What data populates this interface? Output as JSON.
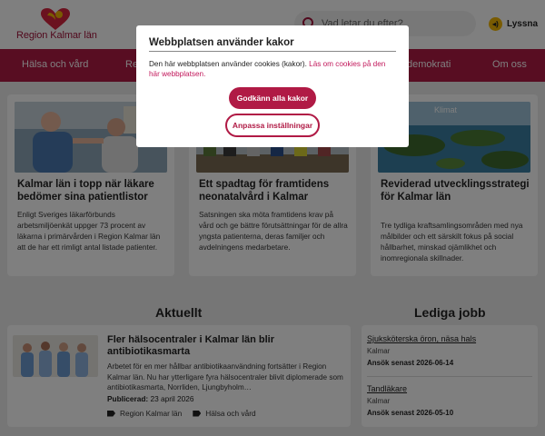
{
  "header": {
    "logo_text": "Region Kalmar län",
    "search_placeholder": "Vad letar du efter?",
    "listen_label": "Lyssna"
  },
  "nav": {
    "items": [
      {
        "label": "Hälsa och vård"
      },
      {
        "label": "Re"
      },
      {
        "label": "demokrati"
      },
      {
        "label": "Om oss"
      }
    ]
  },
  "cards": [
    {
      "title": "Kalmar län i topp när läkare bedömer sina patientlistor",
      "text": "Enligt Sveriges läkarförbunds arbetsmiljöenkät uppger 73 procent av läkarna i primärvården i Region Kalmar län att de har ett rimligt antal listade patienter."
    },
    {
      "title": "Ett spadtag för framtidens neonatalvård i Kalmar",
      "text": "Satsningen ska möta framtidens krav på vård och ge bättre förutsättningar för de allra yngsta patienterna, deras familjer och avdelningens medarbetare."
    },
    {
      "title": "Reviderad utvecklingsstrategi för Kalmar län",
      "text": "Tre tydliga kraftsamlingsområden med nya målbilder och ett särskilt fokus på social hållbarhet, minskad ojämlikhet och inomregionala skillnader.",
      "image_caption": "Klimat"
    }
  ],
  "aktuellt": {
    "heading": "Aktuellt",
    "title": "Fler hälsocentraler i Kalmar län blir antibiotikasmarta",
    "text": "Arbetet för en mer hållbar antibiotikaanvändning fortsätter i Region Kalmar län. Nu har ytterligare fyra hälsocentraler blivit diplomerade som antibiotikasmarta, Norrliden, Ljungbyholm…",
    "date_label": "Publicerad:",
    "date_value": "23 april 2026",
    "tags": [
      "Region Kalmar län",
      "Hälsa och vård"
    ]
  },
  "jobs": {
    "heading": "Lediga jobb",
    "items": [
      {
        "title": "Sjuksköterska öron, näsa hals",
        "location": "Kalmar",
        "deadline": "Ansök senast 2026-06-14"
      },
      {
        "title": "Tandläkare",
        "location": "Kalmar",
        "deadline": "Ansök senast 2026-05-10"
      }
    ]
  },
  "cookie": {
    "title": "Webbplatsen använder kakor",
    "text": "Den här webbplatsen använder cookies (kakor).",
    "link": "Läs om cookies på den här webbplatsen.",
    "accept_label": "Godkänn alla kakor",
    "customize_label": "Anpassa inställningar"
  },
  "colors": {
    "brand": "#b01a45",
    "overlay": "rgba(0,0,0,0.5)"
  }
}
